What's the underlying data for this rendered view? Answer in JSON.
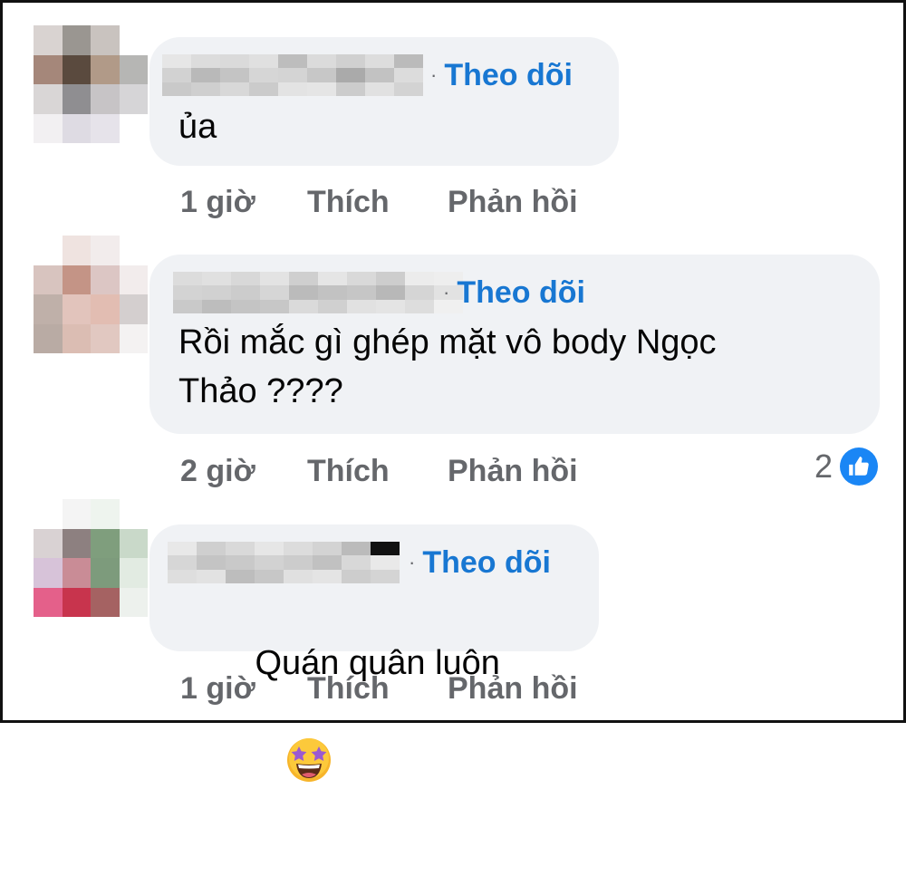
{
  "separator": "·",
  "comments": [
    {
      "follow_label": "Theo dõi",
      "text": "ủa",
      "time": "1 giờ",
      "like_label": "Thích",
      "reply_label": "Phản hồi",
      "avatar_colors": [
        "#d9d3d1",
        "#9a9691",
        "#c9c3bf",
        "#ffffff",
        "#a5877a",
        "#5a4a3e",
        "#b19a88",
        "#b6b6b4",
        "#d9d6d6",
        "#8f8e91",
        "#c7c4c6",
        "#d6d5d7",
        "#f2f0f2",
        "#dedbe3",
        "#e6e3ea",
        "#ffffff"
      ]
    },
    {
      "follow_label": "Theo dõi",
      "text": "Rồi mắc gì ghép mặt vô body Ngọc\nThảo ????",
      "time": "2 giờ",
      "like_label": "Thích",
      "reply_label": "Phản hồi",
      "reaction_count": "2",
      "reaction_icon": "like-thumb-icon",
      "avatar_colors": [
        "#ffffff",
        "#efe3e0",
        "#f2ecec",
        "#ffffff",
        "#d8c4bf",
        "#c49486",
        "#dcc6c4",
        "#f2ecec",
        "#bfb0a9",
        "#e2c4bc",
        "#e2bdb2",
        "#d4cfcf",
        "#b9aba4",
        "#dbbdb3",
        "#e1c8c1",
        "#f4f2f2"
      ]
    },
    {
      "follow_label": "Theo dõi",
      "text": "Quán quân luôn",
      "emoji": "star-struck-emoji",
      "time": "1 giờ",
      "like_label": "Thích",
      "reply_label": "Phản hồi",
      "avatar_colors": [
        "#ffffff",
        "#f4f4f4",
        "#eef4ee",
        "#ffffff",
        "#d9d2d3",
        "#8d8080",
        "#7f9e7d",
        "#c9d9c9",
        "#d7c3d9",
        "#c98c96",
        "#7d9b7c",
        "#e2ebe2",
        "#e4608a",
        "#c8344d",
        "#a56262",
        "#edf1ed"
      ]
    }
  ],
  "blurred_name_colors": [
    [
      "#e6e6e6",
      "#d2d2d2",
      "#c9c9c9",
      "#dcdcdc",
      "#b9b9b9",
      "#cfcfcf",
      "#dadada",
      "#c4c4c4",
      "#d8d8d8",
      "#e0e0e0",
      "#d6d6d6",
      "#cbcbcb",
      "#bdbdbd",
      "#d4d4d4",
      "#e3e3e3",
      "#dbdbdb",
      "#c7c7c7",
      "#e5e5e5",
      "#d0d0d0",
      "#aaaaaa",
      "#cccccc",
      "#dddddd",
      "#c2c2c2",
      "#e1e1e1",
      "#bbbbbb",
      "#dcdcdc",
      "#d3d3d3"
    ],
    [
      "#dcdcdc",
      "#d3d3d3",
      "#c9c9c9",
      "#e0e0e0",
      "#d1d1d1",
      "#bdbdbd",
      "#d8d8d8",
      "#cccccc",
      "#c4c4c4",
      "#e3e3e3",
      "#d6d6d6",
      "#c7c7c7",
      "#cfcfcf",
      "#bbbbbb",
      "#dadada",
      "#e5e5e5",
      "#c2c2c2",
      "#d0d0d0",
      "#d9d9d9",
      "#c6c6c6",
      "#e1e1e1",
      "#cdcdcd",
      "#b8b8b8",
      "#e4e4e4",
      "#ececec",
      "#d5d5d5",
      "#dddddd",
      "#eeeeee",
      "#e2e2e2",
      "#f0f0f0"
    ],
    [
      "#e8e8e8",
      "#d6d6d6",
      "#dedede",
      "#cfcfcf",
      "#c4c4c4",
      "#e2e2e2",
      "#d9d9d9",
      "#c9c9c9",
      "#bdbdbd",
      "#e6e6e6",
      "#d2d2d2",
      "#c7c7c7",
      "#dcdcdc",
      "#cccccc",
      "#e0e0e0",
      "#d3d3d3",
      "#c1c1c1",
      "#e4e4e4",
      "#bbbbbb",
      "#d8d8d8",
      "#cdcdcd",
      "#111111",
      "#e9e9e9",
      "#d4d4d4"
    ]
  ]
}
